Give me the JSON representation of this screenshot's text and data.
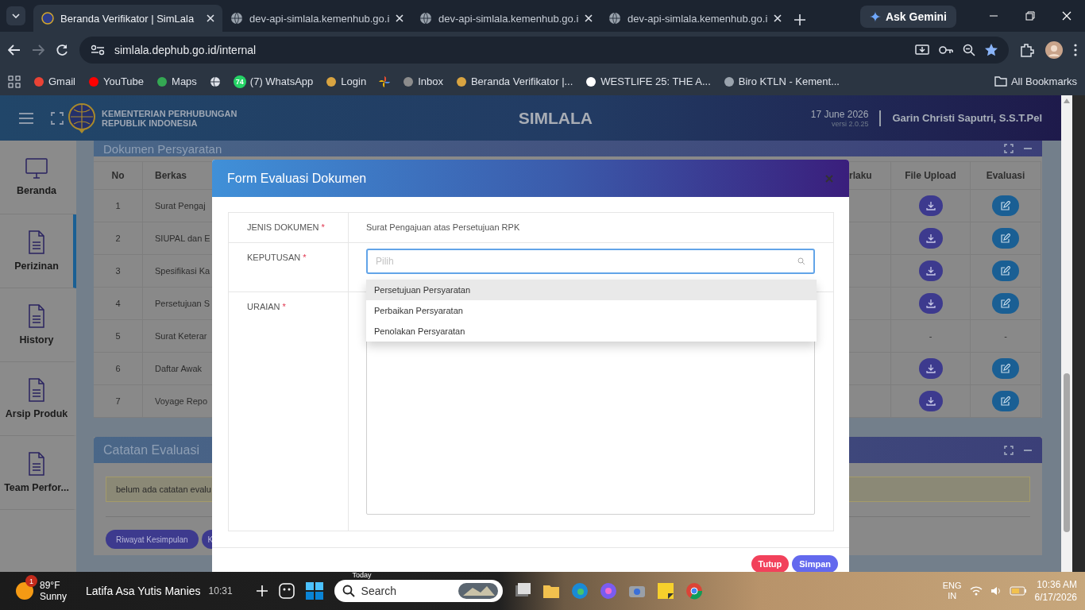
{
  "browser": {
    "tabs": [
      {
        "title": "Beranda Verifikator | SimLala",
        "selected": true
      },
      {
        "title": "dev-api-simlala.kemenhub.go.i",
        "selected": false
      },
      {
        "title": "dev-api-simlala.kemenhub.go.i",
        "selected": false
      },
      {
        "title": "dev-api-simlala.kemenhub.go.i",
        "selected": false
      }
    ],
    "gemini": "Ask Gemini",
    "url": "simlala.dephub.go.id/internal",
    "bookmarks": [
      {
        "kind": "link",
        "label": "Gmail"
      },
      {
        "kind": "link",
        "label": "YouTube"
      },
      {
        "kind": "link",
        "label": "Maps"
      },
      {
        "kind": "icon"
      },
      {
        "kind": "link",
        "label": "(7) WhatsApp",
        "badge": "74"
      },
      {
        "kind": "link",
        "label": "Login"
      },
      {
        "kind": "icon"
      },
      {
        "kind": "link",
        "label": "Inbox"
      },
      {
        "kind": "link",
        "label": "Beranda Verifikator |..."
      },
      {
        "kind": "link",
        "label": "WESTLIFE 25: THE A..."
      },
      {
        "kind": "link",
        "label": "Biro KTLN - Kement..."
      }
    ],
    "all_bookmarks": "All Bookmarks"
  },
  "header": {
    "org_line_1": "KEMENTERIAN PERHUBUNGAN",
    "org_line_2": "REPUBLIK INDONESIA",
    "app_name": "SIMLALA",
    "date": "17 June 2026",
    "version": "versi 2.0.25",
    "user": "Garin Christi Saputri, S.S.T.Pel"
  },
  "sidebar": {
    "items": [
      {
        "label": "Beranda",
        "selected": false
      },
      {
        "label": "Perizinan",
        "selected": true
      },
      {
        "label": "History",
        "selected": false
      },
      {
        "label": "Arsip Produk",
        "selected": false
      },
      {
        "label": "Team Perfor...",
        "selected": false
      }
    ]
  },
  "documents": {
    "title": "Dokumen Persyaratan",
    "columns": [
      "No",
      "Berkas",
      "rlaku",
      "File Upload",
      "Evaluasi"
    ],
    "rows": [
      {
        "no": "1",
        "berkas": "Surat Pengaj",
        "actions": true
      },
      {
        "no": "2",
        "berkas": "SIUPAL dan E",
        "actions": true
      },
      {
        "no": "3",
        "berkas": "Spesifikasi Ka",
        "actions": true
      },
      {
        "no": "4",
        "berkas": "Persetujuan S",
        "actions": true
      },
      {
        "no": "5",
        "berkas": "Surat Keterar",
        "actions": false,
        "file_upload": "-",
        "evaluasi": "-"
      },
      {
        "no": "6",
        "berkas": "Daftar Awak",
        "actions": true
      },
      {
        "no": "7",
        "berkas": "Voyage Repo",
        "actions": true
      }
    ]
  },
  "notes": {
    "title": "Catatan Evaluasi",
    "message": "belum ada catatan evalu",
    "buttons": [
      "Riwayat Kesimpulan",
      "K"
    ]
  },
  "modal": {
    "title": "Form Evaluasi Dokumen",
    "fields": [
      {
        "kind": "text",
        "label": "JENIS DOKUMEN",
        "mark": "*",
        "value": "Surat Pengajuan atas Persetujuan RPK"
      },
      {
        "kind": "select",
        "label": "KEPUTUSAN",
        "mark": "*",
        "placeholder": "Pilih",
        "options": [
          {
            "label": "Persetujuan Persyaratan",
            "selected": true
          },
          {
            "label": "Perbaikan Persyaratan",
            "selected": false
          },
          {
            "label": "Penolakan Persyaratan",
            "selected": false
          }
        ]
      },
      {
        "kind": "textarea",
        "label": "URAIAN",
        "mark": "*"
      }
    ],
    "buttons": [
      {
        "kind": "cancel",
        "label": "Tutup"
      },
      {
        "kind": "primary",
        "label": "Simpan"
      }
    ]
  },
  "taskbar": {
    "weather": {
      "badge": "1",
      "temp": "89°F",
      "condition": "Sunny"
    },
    "news": {
      "title": "Latifa Asa Yutis Manies",
      "time": "10:31"
    },
    "today": "Today",
    "search": {
      "placeholder": "Search"
    },
    "language": "ENG",
    "region": "IN",
    "time": "10:36 AM",
    "date": "6/17/2026"
  }
}
